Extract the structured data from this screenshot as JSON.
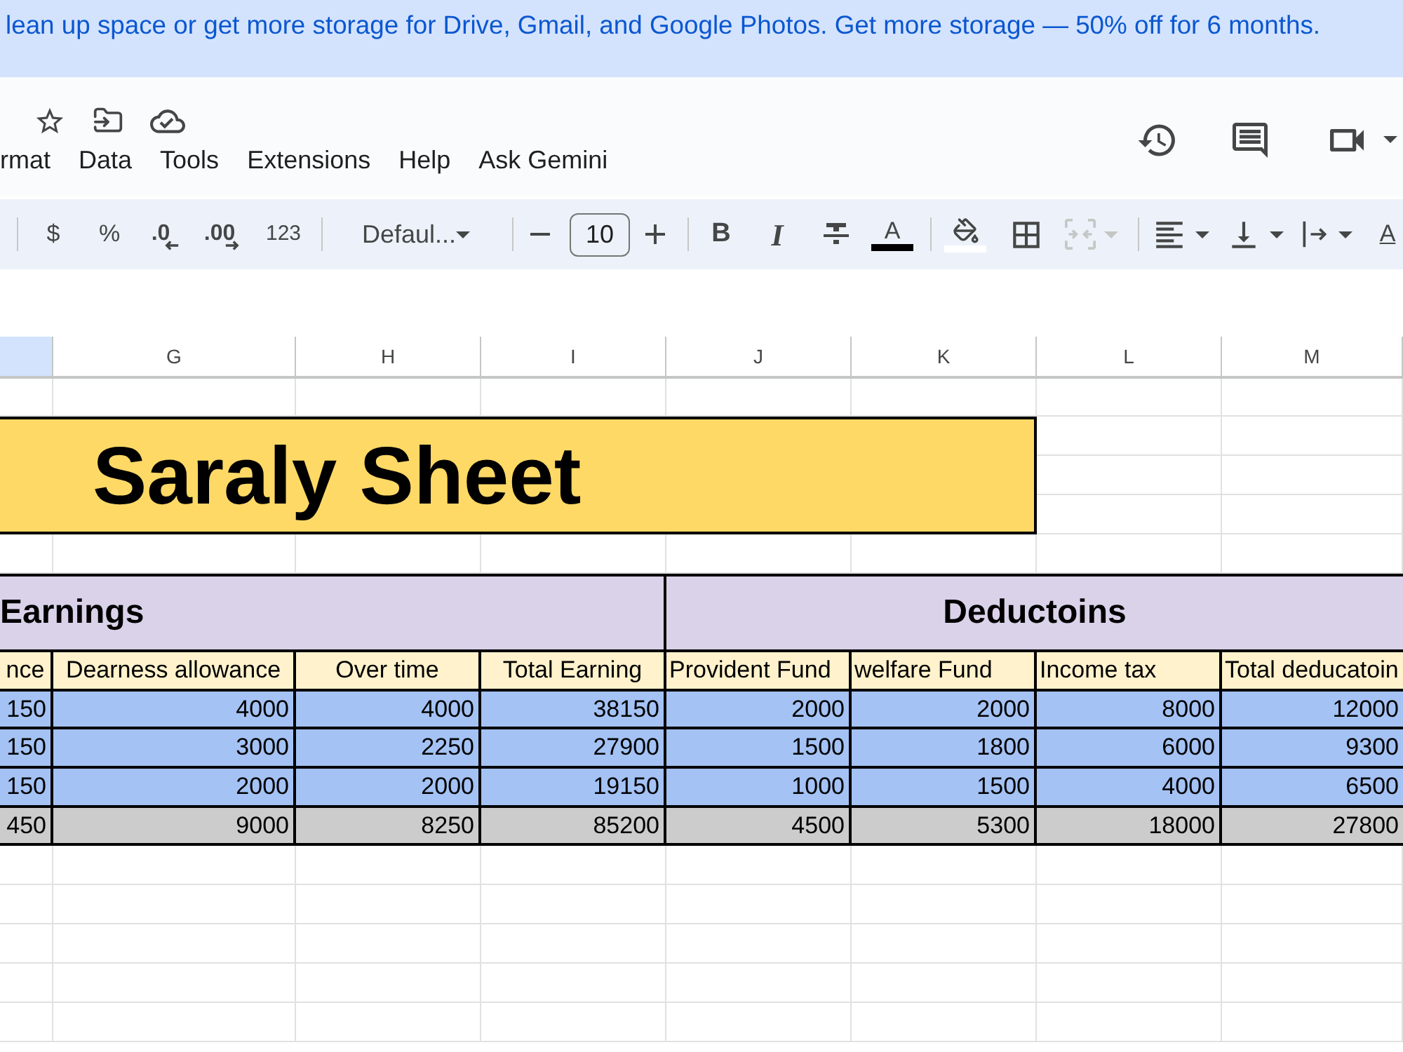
{
  "banner": {
    "text": "lean up space or get more storage for Drive, Gmail, and Google Photos. Get more storage — 50% off for 6 months."
  },
  "menu": [
    "rmat",
    "Data",
    "Tools",
    "Extensions",
    "Help",
    "Ask Gemini"
  ],
  "toolbar": {
    "currency": "$",
    "percent": "%",
    "decrease_decimals": ".0",
    "increase_decimals": ".00",
    "number_format": "123",
    "font": "Defaul...",
    "font_size": "10",
    "bold": "B",
    "italic": "I",
    "text_color": {
      "label": "A",
      "color": "#000000"
    },
    "fill_color": {
      "color": "#ffffff"
    },
    "merge": {
      "disabled": true
    },
    "last_item": "A"
  },
  "sheet": {
    "columns": [
      {
        "selected": true
      },
      {
        "label": "G",
        "selected": false
      },
      {
        "label": "H",
        "selected": false
      },
      {
        "label": "I",
        "selected": false
      },
      {
        "label": "J",
        "selected": false
      },
      {
        "label": "K",
        "selected": false
      },
      {
        "label": "L",
        "selected": false
      },
      {
        "label": "M",
        "selected": false
      }
    ],
    "title": "Saraly Sheet",
    "groups": [
      "Earnings",
      "Deductoins"
    ],
    "headers": [
      "nce",
      "Dearness allowance",
      "Over time",
      "Total Earning",
      "Provident Fund",
      "welfare Fund",
      "Income tax",
      "Total deducatoin"
    ],
    "rows": [
      {
        "kind": "entry",
        "cells": [
          "150",
          "4000",
          "4000",
          "38150",
          "2000",
          "2000",
          "8000",
          "12000"
        ]
      },
      {
        "kind": "entry",
        "cells": [
          "150",
          "3000",
          "2250",
          "27900",
          "1500",
          "1800",
          "6000",
          "9300"
        ]
      },
      {
        "kind": "entry",
        "cells": [
          "150",
          "2000",
          "2000",
          "19150",
          "1000",
          "1500",
          "4000",
          "6500"
        ]
      },
      {
        "kind": "total",
        "cells": [
          "450",
          "9000",
          "8250",
          "85200",
          "4500",
          "5300",
          "18000",
          "27800"
        ]
      }
    ]
  }
}
